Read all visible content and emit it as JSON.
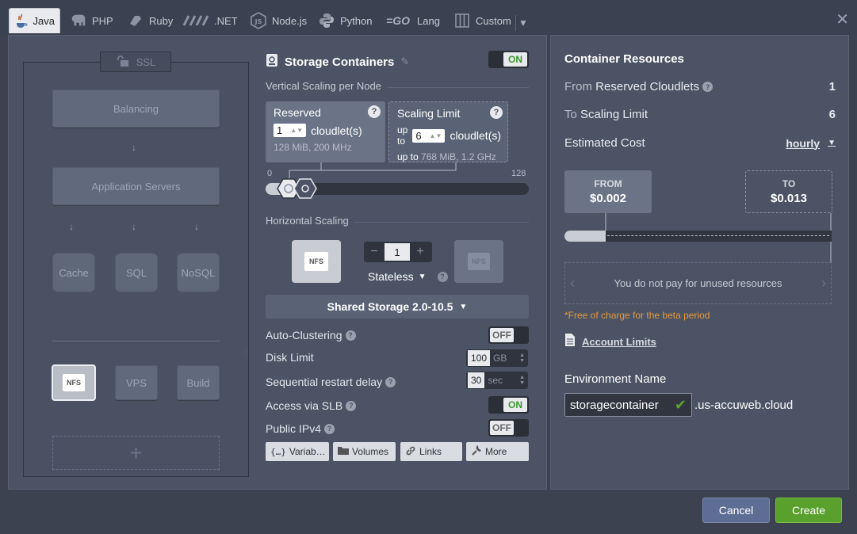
{
  "tabs": [
    {
      "label": "Java",
      "icon": "java-icon",
      "active": true
    },
    {
      "label": "PHP",
      "icon": "elephant-icon"
    },
    {
      "label": "Ruby",
      "icon": "ruby-icon"
    },
    {
      "label": ".NET",
      "icon": "dotnet-icon"
    },
    {
      "label": "Node.js",
      "icon": "nodejs-icon"
    },
    {
      "label": "Python",
      "icon": "python-icon"
    },
    {
      "label": "Lang",
      "icon": "go-icon",
      "icon_text": "=GO"
    },
    {
      "label": "Custom",
      "icon": "grid-icon"
    }
  ],
  "topology": {
    "ssl_label": "SSL",
    "balancing": "Balancing",
    "app_servers": "Application Servers",
    "cache": "Cache",
    "sql": "SQL",
    "nosql": "NoSQL",
    "nfs": "NFS",
    "vps": "VPS",
    "build": "Build",
    "add": "+"
  },
  "storage": {
    "title": "Storage Containers",
    "toggle": "ON",
    "vertical_scaling": "Vertical Scaling per Node",
    "reserved": {
      "title": "Reserved",
      "value": "1",
      "unit": "cloudlet(s)",
      "info": "128 MiB, 200 MHz"
    },
    "limit": {
      "title": "Scaling Limit",
      "up_to": "up to",
      "value": "6",
      "unit": "cloudlet(s)",
      "info_prefix": "up to",
      "info": "768 MiB, 1.2 GHz"
    },
    "slider_min": "0",
    "slider_max": "128",
    "horizontal_scaling": "Horizontal Scaling",
    "node_count": "1",
    "minus": "−",
    "plus": "+",
    "nfs_label": "NFS",
    "stateless": "Stateless",
    "stack": "Shared Storage 2.0-10.5",
    "auto_clustering": "Auto-Clustering",
    "auto_clustering_toggle": "OFF",
    "disk_limit": "Disk Limit",
    "disk_value": "100",
    "disk_unit": "GB",
    "restart_delay": "Sequential restart delay",
    "restart_value": "30",
    "restart_unit": "sec",
    "slb": "Access via SLB",
    "slb_toggle": "ON",
    "ipv4": "Public IPv4",
    "ipv4_toggle": "OFF",
    "buttons": {
      "variables": "Variab…",
      "volumes": "Volumes",
      "links": "Links",
      "more": "More"
    }
  },
  "resources": {
    "title": "Container Resources",
    "from_prefix": "From",
    "from_label": "Reserved Cloudlets",
    "from_value": "1",
    "to_prefix": "To",
    "to_label": "Scaling Limit",
    "to_value": "6",
    "cost_label": "Estimated Cost",
    "cost_period": "hourly",
    "from_box": {
      "label": "FROM",
      "price": "$0.002"
    },
    "to_box": {
      "label": "TO",
      "price": "$0.013"
    },
    "unused_text": "You do not pay for unused resources",
    "beta_note": "*Free of charge for the beta period",
    "account_limits": "Account Limits",
    "env_name_label": "Environment Name",
    "env_name_value": "storagecontainer",
    "domain_suffix": ".us-accuweb.cloud"
  },
  "footer": {
    "cancel": "Cancel",
    "create": "Create"
  },
  "colors": {
    "accent_green": "#5aa02c",
    "cancel_blue": "#5d6d94",
    "beta_note": "#e89a3c",
    "on_green": "#3a9a2a"
  }
}
